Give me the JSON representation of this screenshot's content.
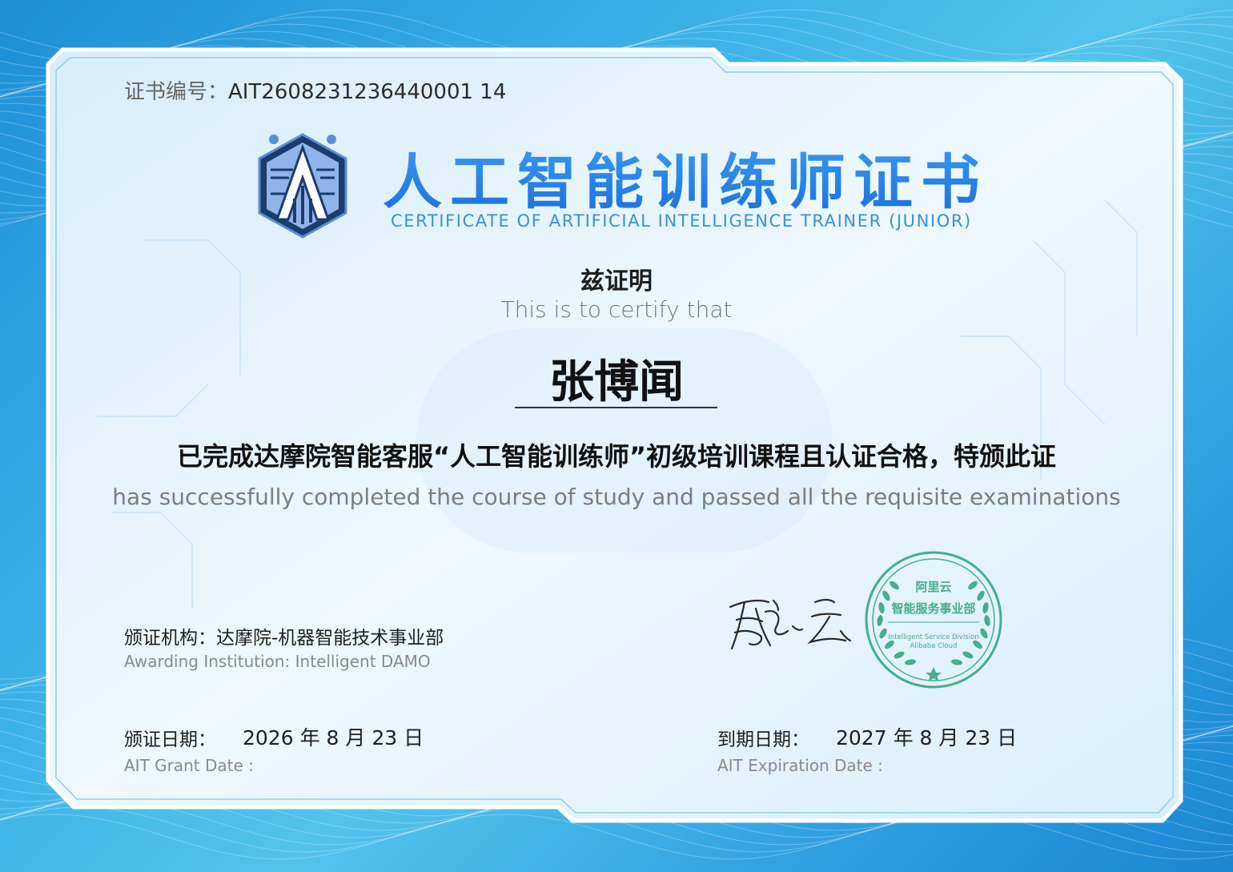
{
  "certificate": {
    "number_label": "证书编号：",
    "number": "AIT2608231236440001 14",
    "title_cn": "人工智能训练师证书",
    "title_en": "CERTIFICATE OF ARTIFICIAL INTELLIGENCE TRAINER (JUNIOR)",
    "hereby_cn": "兹证明",
    "hereby_en": "This is to certify that",
    "holder_name": "张博闻",
    "completion_cn": "已完成达摩院智能客服“人工智能训练师”初级培训课程且认证合格，特颁此证",
    "completion_en": "has successfully completed the course of study and passed all the requisite examinations"
  },
  "institution": {
    "label_cn": "颁证机构：",
    "name_cn": "达摩院-机器智能技术事业部",
    "label_en": "Awarding Institution: Intelligent DAMO"
  },
  "dates": {
    "grant_label_cn": "颁证日期：",
    "grant_value": "2026 年  8  月 23 日",
    "grant_label_en": "AIT Grant Date :",
    "expire_label_cn": "到期日期：",
    "expire_value": "2027 年  8  月 23 日",
    "expire_label_en": "AIT Expiration Date :"
  },
  "seal": {
    "top_text": "阿里云",
    "main_text": "智能服务事业部",
    "en_line1": "Intelligent Service Division",
    "en_line2": "Alibaba Cloud",
    "color": "#47ad8a"
  },
  "signature": {
    "text": "聂云"
  },
  "colors": {
    "border_blue": "#2d8fe0",
    "title_blue": "#1f7ee6",
    "panel": "#e7f4fc"
  }
}
